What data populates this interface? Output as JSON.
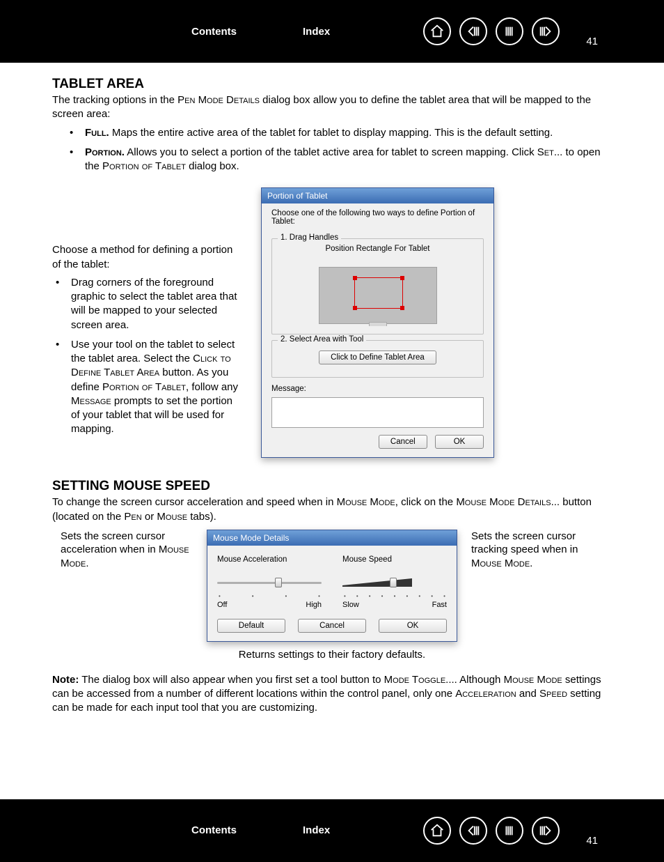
{
  "nav": {
    "contents": "Contents",
    "index": "Index",
    "page": "41"
  },
  "title1": "TABLET AREA",
  "intro_prefix": "The tracking options in the ",
  "intro_scaps1": "Pen Mode Details",
  "intro_suffix": " dialog box allow you to define the tablet area that will be mapped to the screen area:",
  "bullet1_label": "Full.",
  "bullet1_text": "  Maps the entire active area of the tablet for tablet to display mapping.  This is the default setting.",
  "bullet2_label": "Portion.",
  "bullet2_text1": "  Allows you to select a portion of the tablet active area for tablet to screen mapping.  Click ",
  "bullet2_scaps1": "Set",
  "bullet2_text2": "... to open the ",
  "bullet2_scaps2": "Portion of Tablet",
  "bullet2_text3": " dialog box.",
  "side": {
    "choose": "Choose a method for defining a portion of the tablet:",
    "li1": "Drag corners of the foreground graphic to select the tablet area that will be mapped to your selected screen area.",
    "li2a": "Use your tool on the tablet to select the tablet area.  Select the ",
    "li2_scaps1": "Click to Define Tablet Area",
    "li2b": " button.  As you define ",
    "li2_scaps2": "Portion of Tablet",
    "li2c": ", follow any  ",
    "li2_scaps3": "Message",
    "li2d": " prompts to set the portion of your tablet that will be used for mapping."
  },
  "portion_dialog": {
    "title": "Portion of Tablet",
    "instruct": "Choose one of the following two ways to define Portion of Tablet:",
    "g1": "1. Drag Handles",
    "g1_label": "Position Rectangle For Tablet",
    "g2": "2. Select Area with Tool",
    "g2_btn": "Click to Define Tablet Area",
    "msg": "Message:",
    "cancel": "Cancel",
    "ok": "OK"
  },
  "title2": "SETTING MOUSE SPEED",
  "mouse_intro_a": "To change the screen cursor acceleration and speed when in ",
  "mouse_intro_sc1": "Mouse Mode",
  "mouse_intro_b": ", click on the ",
  "mouse_intro_sc2": "Mouse Mode Details",
  "mouse_intro_c": "... button (located on the ",
  "mouse_intro_sc3": "Pen",
  "mouse_intro_d": " or ",
  "mouse_intro_sc4": "Mouse",
  "mouse_intro_e": " tabs).",
  "callout_left_a": "Sets the screen cursor acceleration when in ",
  "callout_left_sc": "Mouse Mode",
  "callout_left_b": ".",
  "callout_right_a": "Sets the screen cursor tracking speed when in ",
  "callout_right_sc": "Mouse Mode",
  "callout_right_b": ".",
  "mouse_dialog": {
    "title": "Mouse Mode Details",
    "accel": "Mouse Acceleration",
    "speed": "Mouse Speed",
    "off": "Off",
    "high": "High",
    "slow": "Slow",
    "fast": "Fast",
    "default": "Default",
    "cancel": "Cancel",
    "ok": "OK"
  },
  "defaults_note": "Returns settings to their factory defaults.",
  "note_label": "Note:",
  "note_a": "The dialog box will also appear when you first set a tool button to ",
  "note_sc1": "Mode Toggle",
  "note_b": "....  Although ",
  "note_sc2": "Mouse Mode",
  "note_c": " settings can be accessed from a number of different locations within the control panel, only one ",
  "note_sc3": "Acceleration",
  "note_d": " and ",
  "note_sc4": "Speed",
  "note_e": " setting can be made for each input tool that you are customizing."
}
